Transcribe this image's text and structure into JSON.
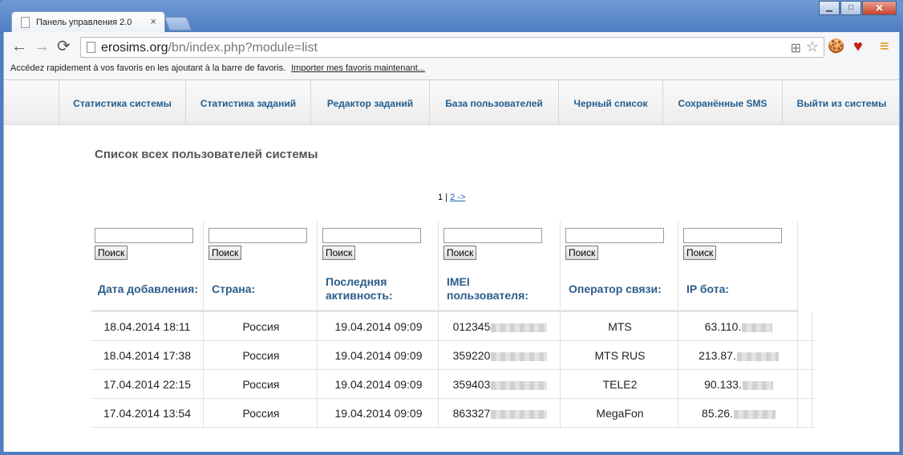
{
  "browser": {
    "tab_title": "Панель управления 2.0",
    "tab_close": "×",
    "url_host": "erosims.org",
    "url_path": "/bn/index.php?module=list",
    "bookmarks_text": "Accédez rapidement à vos favoris en les ajoutant à la barre de favoris.",
    "bookmarks_link": "Importer mes favoris maintenant...",
    "back_icon": "←",
    "forward_icon": "→",
    "reload_icon": "⟳",
    "star_icon": "☆",
    "translate_icon": "⊞",
    "cookie_icon": "🍪",
    "heart_icon": "♥",
    "menu_icon": "≡",
    "window_min": "▁",
    "window_max": "□",
    "window_close": "✕"
  },
  "menu": {
    "items": [
      {
        "label": "Статистика системы"
      },
      {
        "label": "Статистика заданий"
      },
      {
        "label": "Редактор заданий"
      },
      {
        "label": "База пользователей"
      },
      {
        "label": "Черный список"
      },
      {
        "label": "Сохранённые SMS"
      },
      {
        "label": "Выйти из системы"
      }
    ]
  },
  "page": {
    "heading": "Список всех пользователей системы",
    "pager_current": "1",
    "pager_sep": "|",
    "pager_next": "2 ->"
  },
  "search": {
    "button_label": "Поиск"
  },
  "table": {
    "headers": [
      "Дата добавления:",
      "Страна:",
      "Последняя активность:",
      "IMEI пользователя:",
      "Оператор связи:",
      "IP бота:"
    ],
    "rows": [
      {
        "date": "18.04.2014 18:11",
        "country": "Россия",
        "last": "19.04.2014 09:09",
        "imei": "012345",
        "operator": "MTS",
        "ip": "63.110."
      },
      {
        "date": "18.04.2014 17:38",
        "country": "Россия",
        "last": "19.04.2014 09:09",
        "imei": "359220",
        "operator": "MTS RUS",
        "ip": "213.87."
      },
      {
        "date": "17.04.2014 22:15",
        "country": "Россия",
        "last": "19.04.2014 09:09",
        "imei": "359403",
        "operator": "TELE2",
        "ip": "90.133."
      },
      {
        "date": "17.04.2014 13:54",
        "country": "Россия",
        "last": "19.04.2014 09:09",
        "imei": "863327",
        "operator": "MegaFon",
        "ip": "85.26."
      }
    ]
  }
}
